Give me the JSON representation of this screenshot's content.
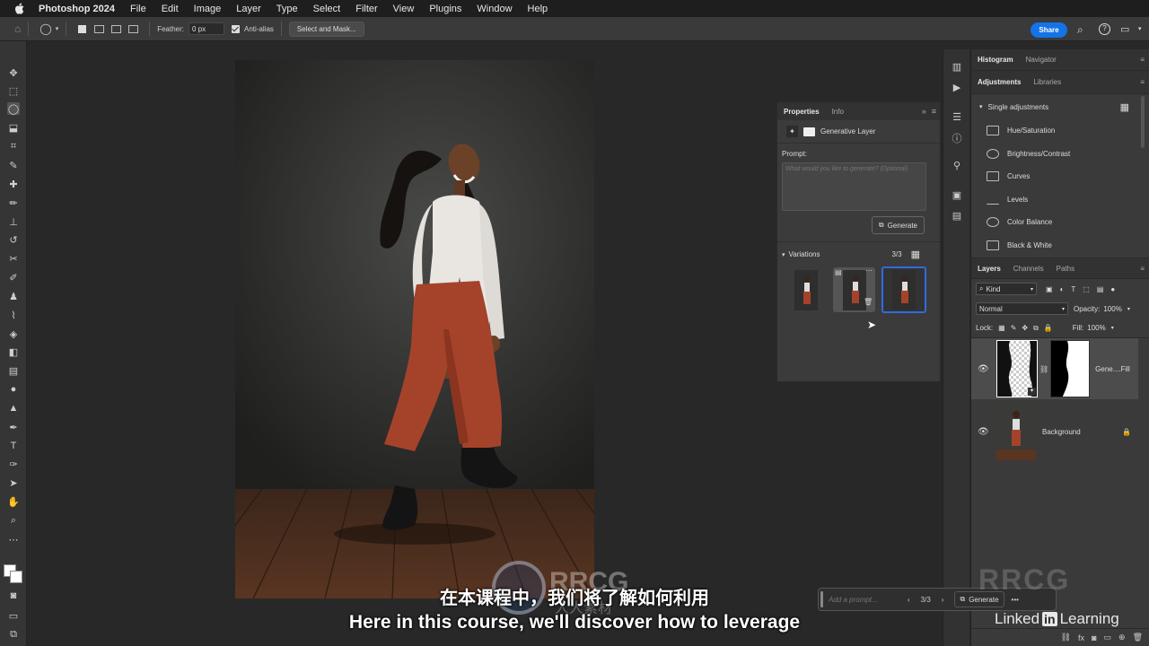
{
  "menubar": {
    "app_name": "Photoshop 2024",
    "items": [
      "File",
      "Edit",
      "Image",
      "Layer",
      "Type",
      "Select",
      "Filter",
      "View",
      "Plugins",
      "Window",
      "Help"
    ]
  },
  "options": {
    "feather_label": "Feather:",
    "feather_value": "0 px",
    "antialias_label": "Anti-alias",
    "select_mask_label": "Select and Mask...",
    "share_label": "Share"
  },
  "properties": {
    "tabs": [
      "Properties",
      "Info"
    ],
    "layer_type": "Generative Layer",
    "prompt_label": "Prompt:",
    "prompt_placeholder": "What would you like to generate? (Optional)",
    "generate_label": "Generate",
    "variations_label": "Variations",
    "variations_count": "3/3"
  },
  "right_panel": {
    "top_tabs": [
      "Histogram",
      "Navigator"
    ],
    "adj_tabs": [
      "Adjustments",
      "Libraries"
    ],
    "single_adjustments": "Single adjustments",
    "adjustments": [
      "Hue/Saturation",
      "Brightness/Contrast",
      "Curves",
      "Levels",
      "Color Balance",
      "Black & White"
    ],
    "layer_tabs": [
      "Layers",
      "Channels",
      "Paths"
    ],
    "kind_label": "Kind",
    "blend_mode": "Normal",
    "opacity_label": "Opacity:",
    "opacity_value": "100%",
    "lock_label": "Lock:",
    "fill_label": "Fill:",
    "fill_value": "100%",
    "layers": [
      {
        "name": "Gene....Fill"
      },
      {
        "name": "Background"
      }
    ]
  },
  "contextual_bar": {
    "placeholder": "Add a prompt...",
    "count": "3/3",
    "generate_label": "Generate",
    "more": "•••"
  },
  "subtitles": {
    "chinese": "在本课程中，我们将了解如何利用",
    "english": "Here in this course, we'll discover how to leverage"
  },
  "watermarks": {
    "rrcg": "RRCG",
    "rrcg_sub": "人人素材",
    "linkedin": "Linked",
    "linkedin_in": "in",
    "learning": "Learning"
  },
  "colors": {
    "accent_blue": "#1473e6",
    "selection_blue": "#2f6be0",
    "pants": "#a5432a",
    "floor": "#5a3522"
  }
}
